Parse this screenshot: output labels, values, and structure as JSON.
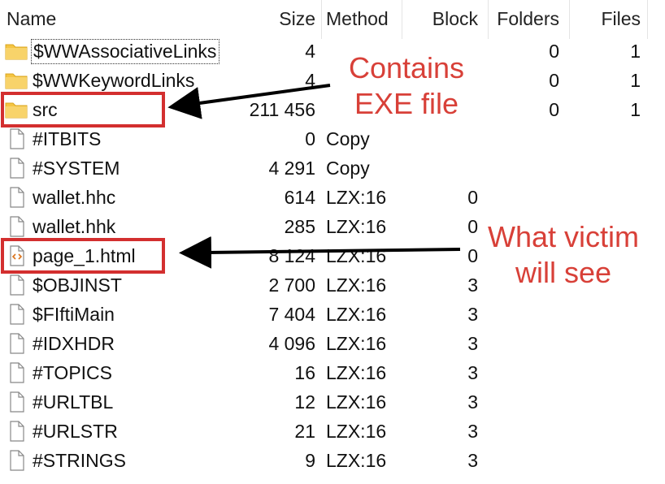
{
  "columns": {
    "name": "Name",
    "size": "Size",
    "method": "Method",
    "block": "Block",
    "folders": "Folders",
    "files": "Files"
  },
  "rows": [
    {
      "icon": "folder-icon",
      "name": "$WWAssociativeLinks",
      "size": "4",
      "method": "",
      "block": "",
      "folders": "0",
      "files": "1"
    },
    {
      "icon": "folder-icon",
      "name": "$WWKeywordLinks",
      "size": "4",
      "method": "",
      "block": "",
      "folders": "0",
      "files": "1"
    },
    {
      "icon": "folder-icon",
      "name": "src",
      "size": "211 456",
      "method": "",
      "block": "",
      "folders": "0",
      "files": "1"
    },
    {
      "icon": "file-icon",
      "name": "#ITBITS",
      "size": "0",
      "method": "Copy",
      "block": "",
      "folders": "",
      "files": ""
    },
    {
      "icon": "file-icon",
      "name": "#SYSTEM",
      "size": "4 291",
      "method": "Copy",
      "block": "",
      "folders": "",
      "files": ""
    },
    {
      "icon": "file-icon",
      "name": "wallet.hhc",
      "size": "614",
      "method": "LZX:16",
      "block": "0",
      "folders": "",
      "files": ""
    },
    {
      "icon": "file-icon",
      "name": "wallet.hhk",
      "size": "285",
      "method": "LZX:16",
      "block": "0",
      "folders": "",
      "files": ""
    },
    {
      "icon": "html-file-icon",
      "name": "page_1.html",
      "size": "8 124",
      "method": "LZX:16",
      "block": "0",
      "folders": "",
      "files": ""
    },
    {
      "icon": "file-icon",
      "name": "$OBJINST",
      "size": "2 700",
      "method": "LZX:16",
      "block": "3",
      "folders": "",
      "files": ""
    },
    {
      "icon": "file-icon",
      "name": "$FIftiMain",
      "size": "7 404",
      "method": "LZX:16",
      "block": "3",
      "folders": "",
      "files": ""
    },
    {
      "icon": "file-icon",
      "name": "#IDXHDR",
      "size": "4 096",
      "method": "LZX:16",
      "block": "3",
      "folders": "",
      "files": ""
    },
    {
      "icon": "file-icon",
      "name": "#TOPICS",
      "size": "16",
      "method": "LZX:16",
      "block": "3",
      "folders": "",
      "files": ""
    },
    {
      "icon": "file-icon",
      "name": "#URLTBL",
      "size": "12",
      "method": "LZX:16",
      "block": "3",
      "folders": "",
      "files": ""
    },
    {
      "icon": "file-icon",
      "name": "#URLSTR",
      "size": "21",
      "method": "LZX:16",
      "block": "3",
      "folders": "",
      "files": ""
    },
    {
      "icon": "file-icon",
      "name": "#STRINGS",
      "size": "9",
      "method": "LZX:16",
      "block": "3",
      "folders": "",
      "files": ""
    }
  ],
  "annotations": {
    "contains_line1": "Contains",
    "contains_line2": "EXE file",
    "victim_line1": "What victim",
    "victim_line2": "will see",
    "color": "#d84038",
    "box_color": "#d32f2f"
  },
  "colors": {
    "folder": "#f5c542",
    "html_icon": "#d9731c"
  }
}
